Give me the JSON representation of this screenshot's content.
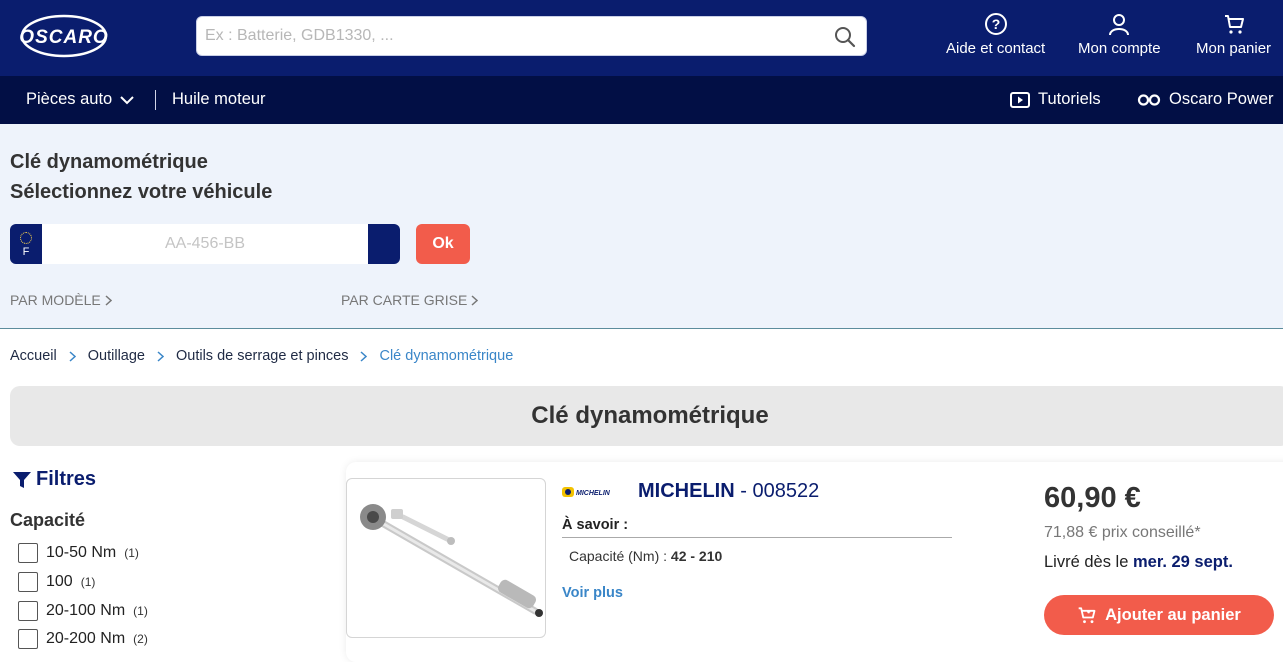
{
  "header": {
    "logo_text": "OSCARO",
    "search_placeholder": "Ex : Batterie, GDB1330, ...",
    "help_label": "Aide et contact",
    "account_label": "Mon compte",
    "cart_label": "Mon panier"
  },
  "nav": {
    "parts_label": "Pièces auto",
    "oil_label": "Huile moteur",
    "tutorials_label": "Tutoriels",
    "power_label": "Oscaro Power"
  },
  "vehicle": {
    "title_line1": "Clé dynamométrique",
    "title_line2": "Sélectionnez votre véhicule",
    "plate_country": "F",
    "plate_placeholder": "AA-456-BB",
    "ok_label": "Ok",
    "by_model": "PAR MODÈLE",
    "by_card": "PAR CARTE GRISE"
  },
  "breadcrumb": [
    "Accueil",
    "Outillage",
    "Outils de serrage et pinces",
    "Clé dynamométrique"
  ],
  "page_title": "Clé dynamométrique",
  "filters": {
    "title": "Filtres",
    "group_label": "Capacité",
    "options": [
      {
        "label": "10-50 Nm",
        "count": "(1)"
      },
      {
        "label": "100",
        "count": "(1)"
      },
      {
        "label": "20-100 Nm",
        "count": "(1)"
      },
      {
        "label": "20-200 Nm",
        "count": "(2)"
      }
    ]
  },
  "product": {
    "brand": "MICHELIN",
    "brand_logo_text": "MICHELIN",
    "dash": " - ",
    "ref": "008522",
    "savoir_label": "À savoir :",
    "spec_label": "Capacité (Nm) : ",
    "spec_value": "42 - 210",
    "more_label": "Voir plus",
    "price": "60,90 €",
    "old_price": "71,88 € prix conseillé*",
    "delivery_prefix": "Livré dès le ",
    "delivery_date": "mer. 29 sept.",
    "cart_button": "Ajouter au panier"
  },
  "colors": {
    "header_bg": "#0a1d6e",
    "nav_bg": "#020f45",
    "accent": "#f25c4b",
    "link": "#3a86c8"
  }
}
